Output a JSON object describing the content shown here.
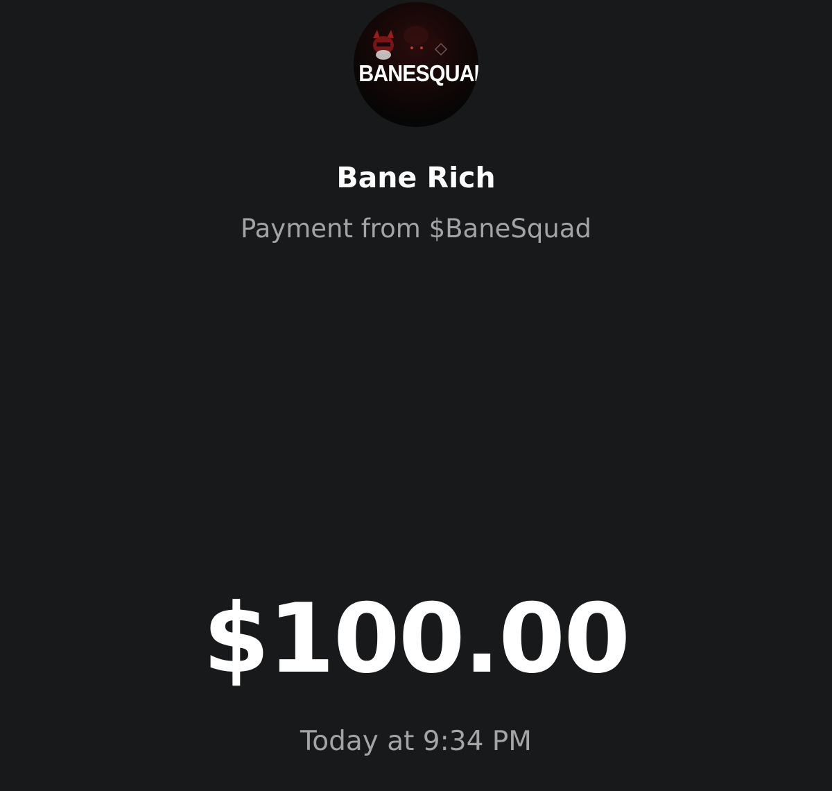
{
  "avatar": {
    "text": "BANESQUAD",
    "icon": "banesquad-logo-avatar"
  },
  "payment": {
    "name": "Bane Rich",
    "subtitle": "Payment from $BaneSquad",
    "amount": "$100.00",
    "timestamp": "Today at 9:34 PM"
  },
  "colors": {
    "background": "#18191b",
    "primary_text": "#ffffff",
    "secondary_text": "#a4a4a6",
    "avatar_accent": "#8b1a1a"
  }
}
